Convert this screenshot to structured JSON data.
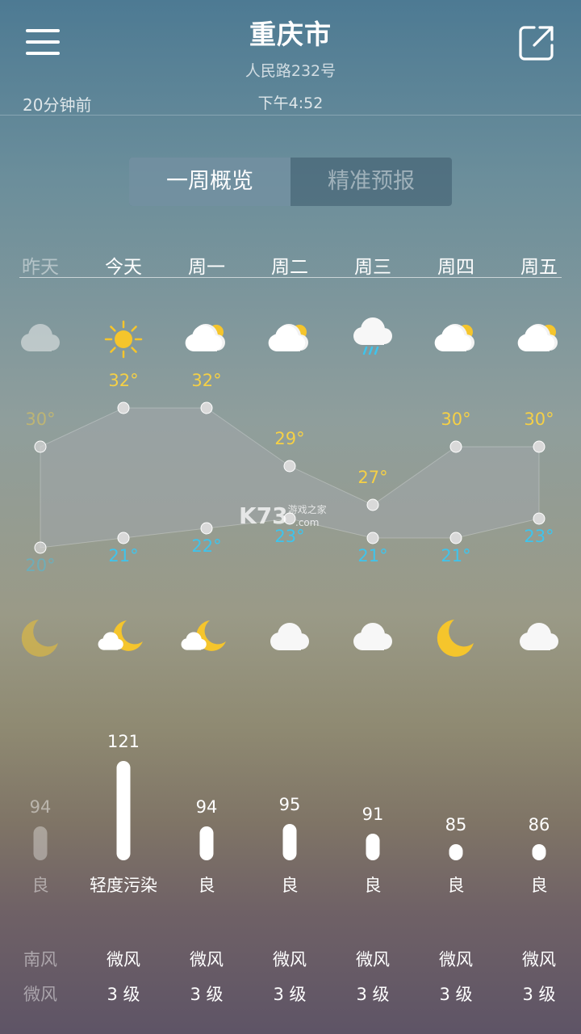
{
  "header": {
    "city": "重庆市",
    "address": "人民路232号",
    "updated": "20分钟前",
    "publish_time": "下午4:52"
  },
  "tabs": [
    {
      "label": "一周概览",
      "active": true
    },
    {
      "label": "精准预报",
      "active": false
    }
  ],
  "watermark": {
    "main": "K73",
    "sub": "游戏之家",
    "domain": ".com"
  },
  "colors": {
    "high_temp": "#f5d046",
    "low_temp": "#3fc4ec",
    "sun": "#f5c52c",
    "rain": "#3fc4ec"
  },
  "days": [
    {
      "name": "昨天",
      "past": true,
      "day_icon": "cloudy-icon",
      "night_icon": "moon-icon",
      "high": "30°",
      "low": "20°",
      "high_value": 30,
      "low_value": 20,
      "aqi": "94",
      "aqi_value": 94,
      "aqi_level": "良",
      "wind_dir": "南风",
      "wind_level": "微风"
    },
    {
      "name": "今天",
      "past": false,
      "day_icon": "sunny-icon",
      "night_icon": "moon-cloud-icon",
      "high": "32°",
      "low": "21°",
      "high_value": 32,
      "low_value": 21,
      "aqi": "121",
      "aqi_value": 121,
      "aqi_level": "轻度污染",
      "wind_dir": "微风",
      "wind_level": "3 级"
    },
    {
      "name": "周一",
      "past": false,
      "day_icon": "partly-cloudy-icon",
      "night_icon": "moon-cloud-icon",
      "high": "32°",
      "low": "22°",
      "high_value": 32,
      "low_value": 22,
      "aqi": "94",
      "aqi_value": 94,
      "aqi_level": "良",
      "wind_dir": "微风",
      "wind_level": "3 级"
    },
    {
      "name": "周二",
      "past": false,
      "day_icon": "partly-cloudy-icon",
      "night_icon": "cloudy-icon",
      "high": "29°",
      "low": "23°",
      "high_value": 29,
      "low_value": 23,
      "aqi": "95",
      "aqi_value": 95,
      "aqi_level": "良",
      "wind_dir": "微风",
      "wind_level": "3 级"
    },
    {
      "name": "周三",
      "past": false,
      "day_icon": "rain-icon",
      "night_icon": "cloudy-icon",
      "high": "27°",
      "low": "21°",
      "high_value": 27,
      "low_value": 21,
      "aqi": "91",
      "aqi_value": 91,
      "aqi_level": "良",
      "wind_dir": "微风",
      "wind_level": "3 级"
    },
    {
      "name": "周四",
      "past": false,
      "day_icon": "partly-cloudy-icon",
      "night_icon": "moon-icon",
      "high": "30°",
      "low": "21°",
      "high_value": 30,
      "low_value": 21,
      "aqi": "85",
      "aqi_value": 85,
      "aqi_level": "良",
      "wind_dir": "微风",
      "wind_level": "3 级"
    },
    {
      "name": "周五",
      "past": false,
      "day_icon": "partly-cloudy-icon",
      "night_icon": "cloudy-icon",
      "high": "30°",
      "low": "23°",
      "high_value": 30,
      "low_value": 23,
      "aqi": "86",
      "aqi_value": 86,
      "aqi_level": "良",
      "wind_dir": "微风",
      "wind_level": "3 级"
    }
  ]
}
